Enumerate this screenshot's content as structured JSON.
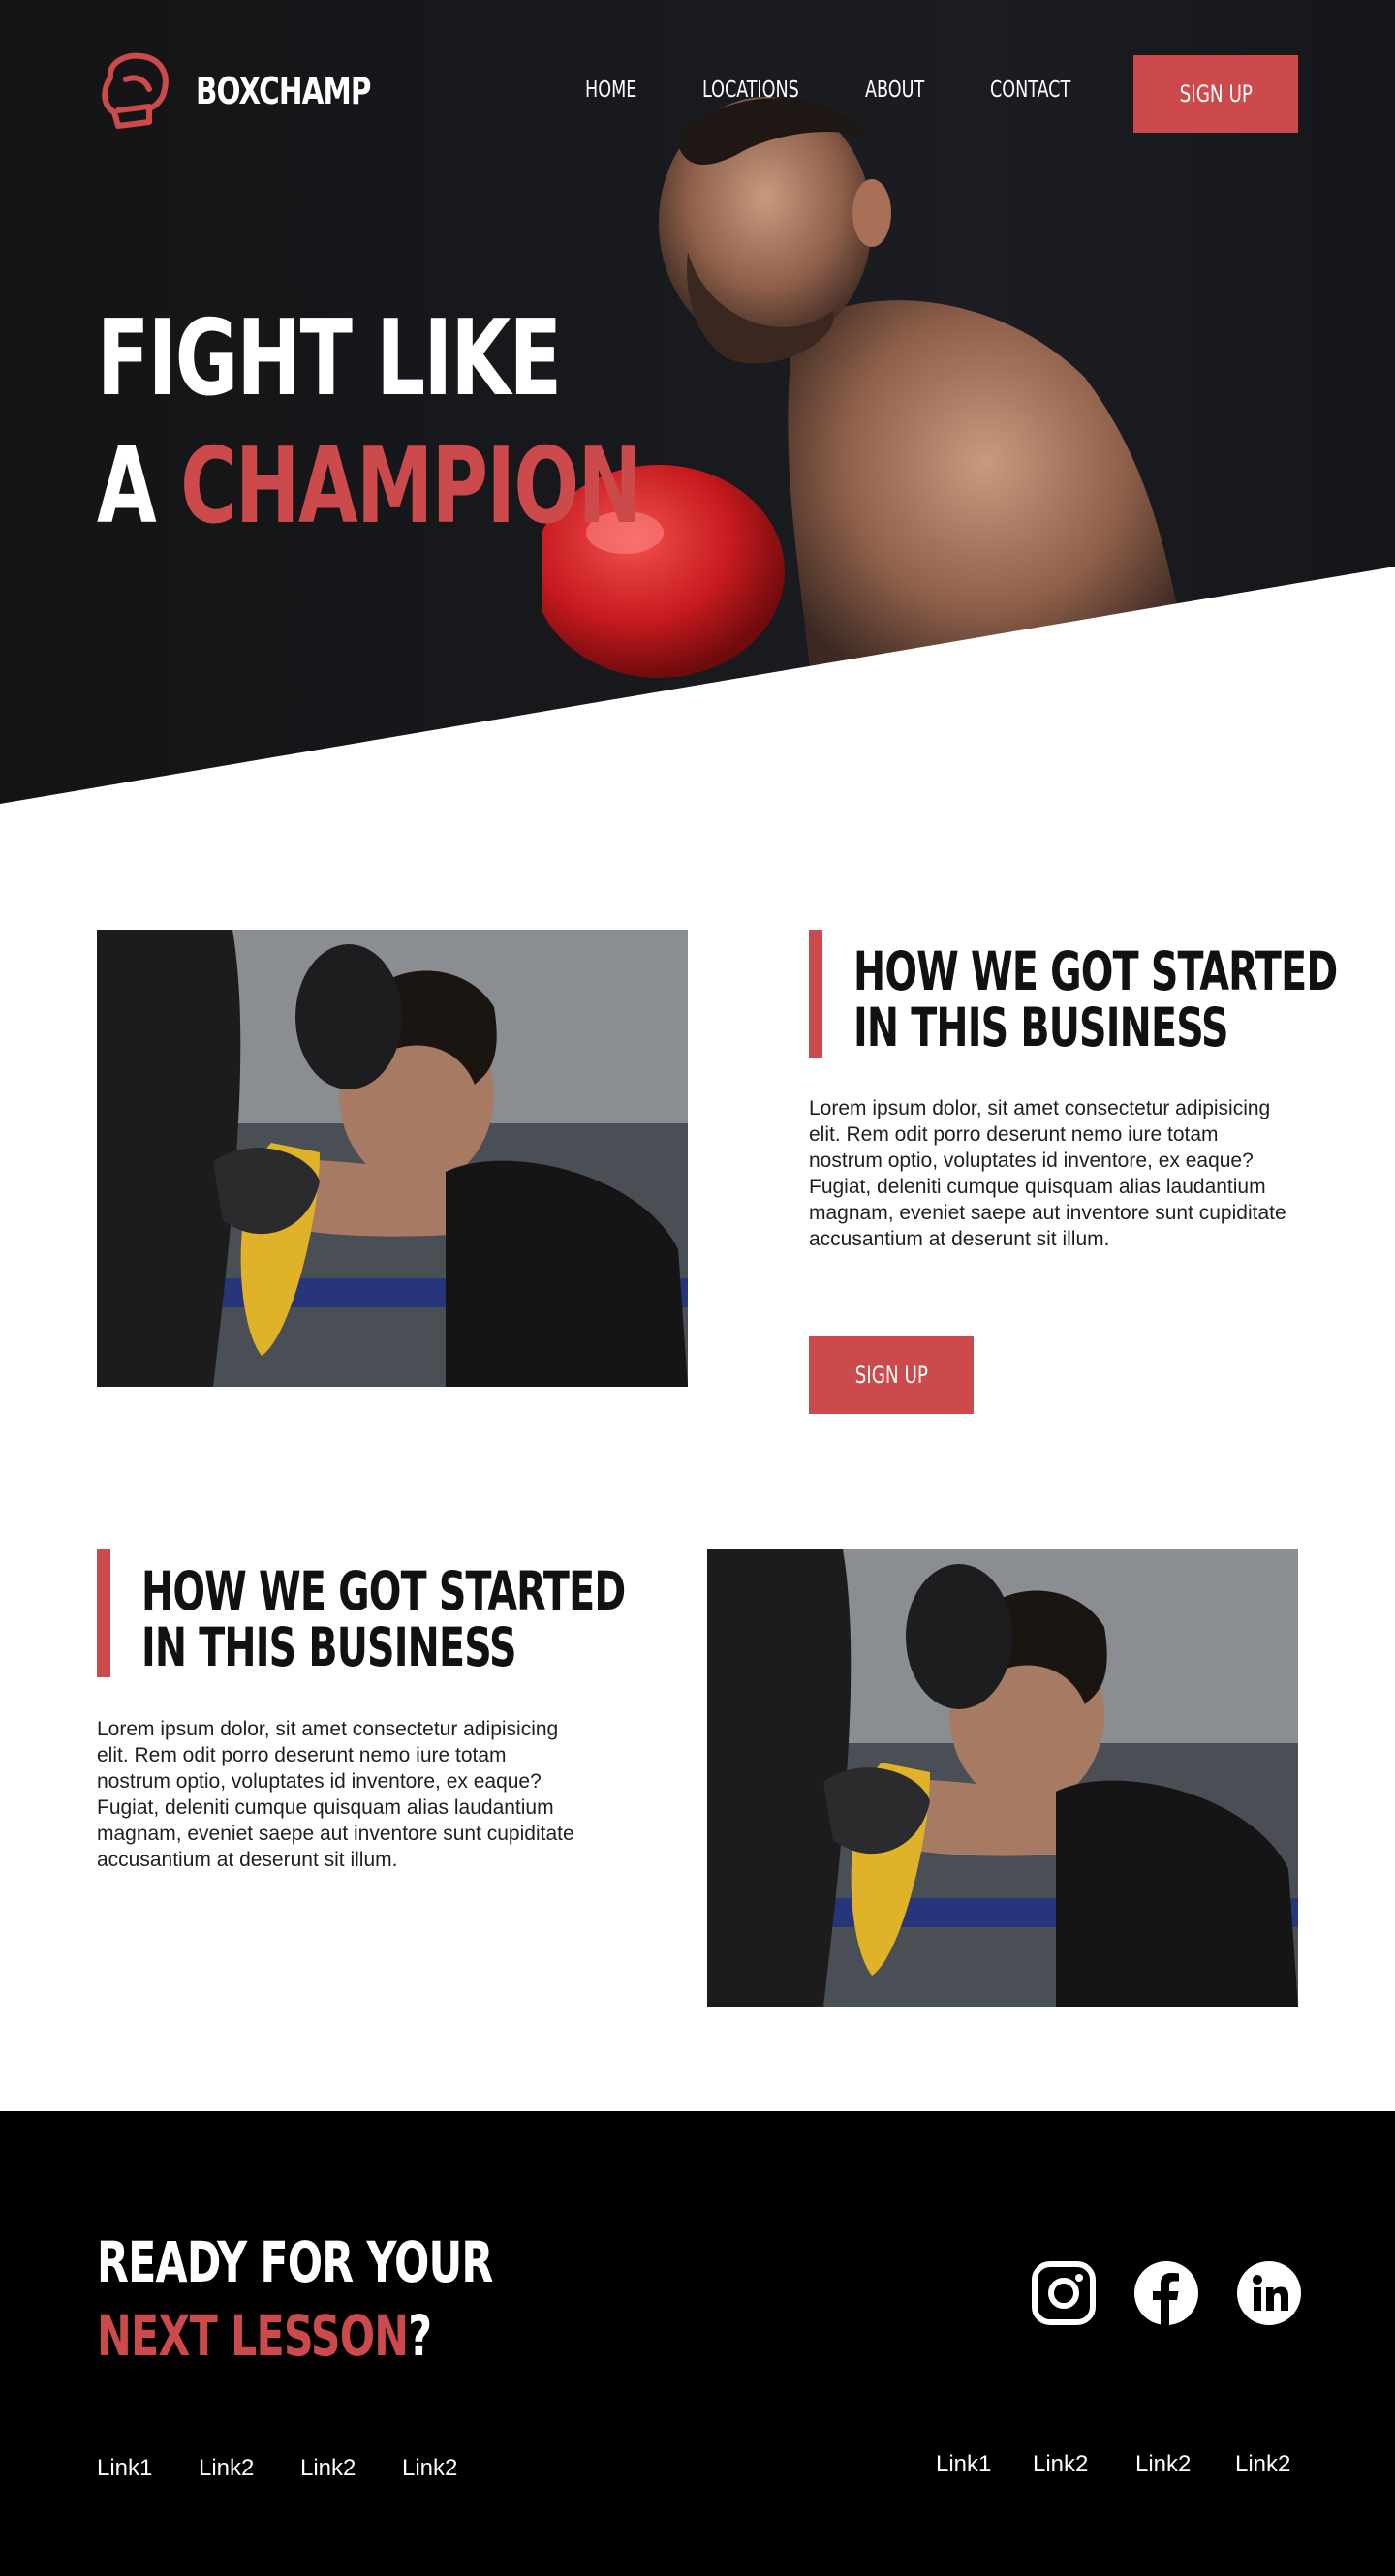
{
  "brand": {
    "name": "BOXCHAMP",
    "logo_icon": "boxing-glove-icon",
    "accent_color": "#cc4a4c"
  },
  "nav": {
    "items": [
      "HOME",
      "LOCATIONS",
      "ABOUT",
      "CONTACT"
    ],
    "signup_label": "SIGN UP"
  },
  "hero": {
    "title_line1": "FIGHT LIKE",
    "title_line2_prefix": "A ",
    "title_line2_accent": "CHAMPION"
  },
  "sections": [
    {
      "heading_line1": "HOW WE GOT STARTED",
      "heading_line2": "IN THIS BUSINESS",
      "body": "Lorem ipsum dolor, sit amet consectetur adipisicing elit. Rem odit porro deserunt nemo iure totam nostrum optio, voluptates id inventore, ex eaque? Fugiat, deleniti cumque quisquam alias laudantium magnam, eveniet saepe aut inventore sunt cupiditate accusantium at deserunt sit illum.",
      "button_label": "SIGN UP"
    },
    {
      "heading_line1": "HOW WE GOT STARTED",
      "heading_line2": "IN THIS BUSINESS",
      "body": "Lorem ipsum dolor, sit amet consectetur adipisicing elit. Rem odit porro deserunt nemo iure totam nostrum optio, voluptates id inventore, ex eaque? Fugiat, deleniti cumque quisquam alias laudantium magnam, eveniet saepe aut inventore sunt cupiditate accusantium at deserunt sit illum."
    }
  ],
  "footer": {
    "cta_line1": "READY FOR YOUR",
    "cta_line2_accent": "NEXT LESSON",
    "cta_line2_suffix": "?",
    "socials": [
      "instagram-icon",
      "facebook-icon",
      "linkedin-icon"
    ],
    "links_left": [
      "Link1",
      "Link2",
      "Link2",
      "Link2"
    ],
    "links_right": [
      "Link1",
      "Link2",
      "Link2",
      "Link2"
    ]
  }
}
